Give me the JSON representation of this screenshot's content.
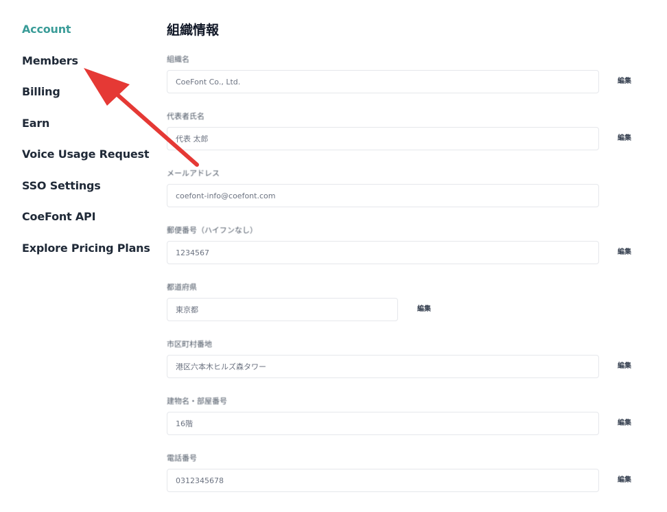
{
  "sidebar": {
    "items": [
      {
        "label": "Account",
        "active": true
      },
      {
        "label": "Members",
        "active": false
      },
      {
        "label": "Billing",
        "active": false
      },
      {
        "label": "Earn",
        "active": false
      },
      {
        "label": "Voice Usage Request",
        "active": false
      },
      {
        "label": "SSO Settings",
        "active": false
      },
      {
        "label": "CoeFont API",
        "active": false
      },
      {
        "label": "Explore Pricing Plans",
        "active": false
      }
    ]
  },
  "main": {
    "title": "組織情報",
    "fields": [
      {
        "label": "組織名",
        "value": "CoeFont Co., Ltd.",
        "edit_label": "編集"
      },
      {
        "label": "代表者氏名",
        "value": "代表 太郎",
        "edit_label": "編集"
      },
      {
        "label": "メールアドレス",
        "value": "coefont-info@coefont.com",
        "edit_label": ""
      },
      {
        "label": "郵便番号（ハイフンなし）",
        "value": "1234567",
        "edit_label": "編集"
      },
      {
        "label": "都道府県",
        "value": "東京都",
        "edit_label": "編集"
      },
      {
        "label": "市区町村番地",
        "value": "港区六本木ヒルズ森タワー",
        "edit_label": "編集"
      },
      {
        "label": "建物名・部屋番号",
        "value": "16階",
        "edit_label": "編集"
      },
      {
        "label": "電話番号",
        "value": "0312345678",
        "edit_label": "編集"
      }
    ]
  },
  "colors": {
    "accent": "#3a9c98",
    "arrow": "#e53935"
  }
}
